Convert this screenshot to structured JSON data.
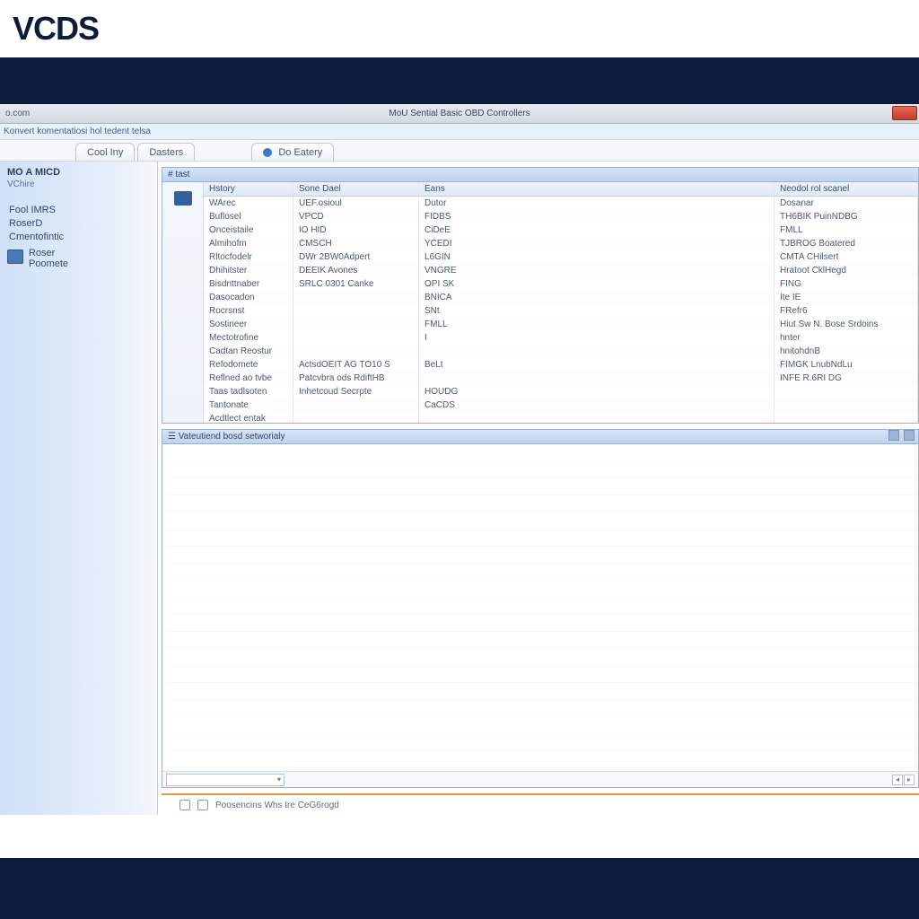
{
  "logo": "VCDS",
  "titlebar": {
    "left": "o.com",
    "center": "MoU Sential Basic OBD Controllers"
  },
  "menubar": "Konvert komentatiosi  hol tedent telsa",
  "tabs": {
    "left_head": "MO A MICD",
    "left_sub": "VChire",
    "tab1": "Cool Iny",
    "tab2": "Dasters",
    "tab3": "Do Eatery"
  },
  "sidebar": {
    "items": [
      "Fool IMRS",
      "RoserD",
      "Cmentofintic"
    ],
    "group": {
      "line1": "Roser",
      "line2": "Poomete"
    }
  },
  "grid": {
    "title": "# tast",
    "columns": [
      "Hstory",
      "Sone Dael",
      "Eans",
      "Neodol rol scanel"
    ],
    "rows": [
      {
        "c0": "WArec",
        "c1": "UEF.osioul",
        "c2": "Dutor",
        "c3": "Dosanar"
      },
      {
        "c0": "Buflosel",
        "c1": "VPCD",
        "c2": "FIDBS",
        "c3": "TH6BIK PuinNDBG"
      },
      {
        "c0": "Onceistaile",
        "c1": "IO HID",
        "c2": "CiDeE",
        "c3": "FMLL"
      },
      {
        "c0": "Almihofm",
        "c1": "CMSCH",
        "c2": "YCEDI",
        "c3": "TJBROG Boatered"
      },
      {
        "c0": "Rltocfodelr",
        "c1": "DWr 2BW0Adpert",
        "c2": "L6GIN",
        "c3": "CMTA CHilsert"
      },
      {
        "c0": "Dhihitster",
        "c1": "DEEIK Avones",
        "c2": "VNGRE",
        "c3": "Hratoot CklHegd"
      },
      {
        "c0": "Bisdnttnaber",
        "c1": "SRLC 0301 Canke",
        "c2": "OPI SK",
        "c3": "FING"
      },
      {
        "c0": "Dasocadon",
        "c1": "",
        "c2": "BNICA",
        "c3": "Ite IE"
      },
      {
        "c0": "Rocrsnst",
        "c1": "",
        "c2": "SNt",
        "c3": "FRefr6"
      },
      {
        "c0": "Sostineer",
        "c1": "",
        "c2": "FMLL",
        "c3": "Hiut Sw N. Bose Srdoins"
      },
      {
        "c0": "Mectotrofine",
        "c1": "",
        "c2": "I",
        "c3": "hnter"
      },
      {
        "c0": "Cadtan Reostur",
        "c1": "",
        "c2": "",
        "c3": "hnitohdnB"
      },
      {
        "c0": "Refodomete",
        "c1": "ActsdOEIT AG TO10  S",
        "c2": "BeLt",
        "c3": "FIMGK LnubNdLu"
      },
      {
        "c0": "Reflned ao tvbe",
        "c1": "Patcvbra ods RdiftHB",
        "c2": "",
        "c3": "INFE R.6RI DG"
      },
      {
        "c0": "Taas tadlsoten",
        "c1": "Inhetcoud Secrpte",
        "c2": "HOUDG",
        "c3": ""
      },
      {
        "c0": "Tantonate",
        "c1": "",
        "c2": "CaCDS",
        "c3": ""
      },
      {
        "c0": "Acdtlect entak",
        "c1": "",
        "c2": "",
        "c3": ""
      }
    ]
  },
  "detail": {
    "title": "Vateutiend bosd setworialy"
  },
  "status": {
    "text": "Poosencins  Whs  Ire CeG6rogd"
  }
}
